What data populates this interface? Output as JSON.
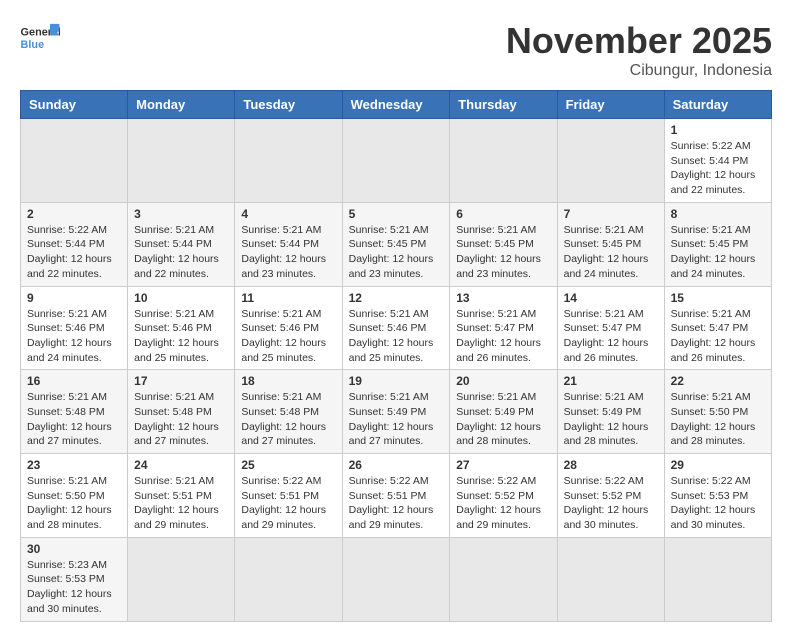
{
  "header": {
    "logo_general": "General",
    "logo_blue": "Blue",
    "title": "November 2025",
    "location": "Cibungur, Indonesia"
  },
  "weekdays": [
    "Sunday",
    "Monday",
    "Tuesday",
    "Wednesday",
    "Thursday",
    "Friday",
    "Saturday"
  ],
  "weeks": [
    [
      {
        "day": "",
        "info": ""
      },
      {
        "day": "",
        "info": ""
      },
      {
        "day": "",
        "info": ""
      },
      {
        "day": "",
        "info": ""
      },
      {
        "day": "",
        "info": ""
      },
      {
        "day": "",
        "info": ""
      },
      {
        "day": "1",
        "info": "Sunrise: 5:22 AM\nSunset: 5:44 PM\nDaylight: 12 hours and 22 minutes."
      }
    ],
    [
      {
        "day": "2",
        "info": "Sunrise: 5:22 AM\nSunset: 5:44 PM\nDaylight: 12 hours and 22 minutes."
      },
      {
        "day": "3",
        "info": "Sunrise: 5:21 AM\nSunset: 5:44 PM\nDaylight: 12 hours and 22 minutes."
      },
      {
        "day": "4",
        "info": "Sunrise: 5:21 AM\nSunset: 5:44 PM\nDaylight: 12 hours and 23 minutes."
      },
      {
        "day": "5",
        "info": "Sunrise: 5:21 AM\nSunset: 5:45 PM\nDaylight: 12 hours and 23 minutes."
      },
      {
        "day": "6",
        "info": "Sunrise: 5:21 AM\nSunset: 5:45 PM\nDaylight: 12 hours and 23 minutes."
      },
      {
        "day": "7",
        "info": "Sunrise: 5:21 AM\nSunset: 5:45 PM\nDaylight: 12 hours and 24 minutes."
      },
      {
        "day": "8",
        "info": "Sunrise: 5:21 AM\nSunset: 5:45 PM\nDaylight: 12 hours and 24 minutes."
      }
    ],
    [
      {
        "day": "9",
        "info": "Sunrise: 5:21 AM\nSunset: 5:46 PM\nDaylight: 12 hours and 24 minutes."
      },
      {
        "day": "10",
        "info": "Sunrise: 5:21 AM\nSunset: 5:46 PM\nDaylight: 12 hours and 25 minutes."
      },
      {
        "day": "11",
        "info": "Sunrise: 5:21 AM\nSunset: 5:46 PM\nDaylight: 12 hours and 25 minutes."
      },
      {
        "day": "12",
        "info": "Sunrise: 5:21 AM\nSunset: 5:46 PM\nDaylight: 12 hours and 25 minutes."
      },
      {
        "day": "13",
        "info": "Sunrise: 5:21 AM\nSunset: 5:47 PM\nDaylight: 12 hours and 26 minutes."
      },
      {
        "day": "14",
        "info": "Sunrise: 5:21 AM\nSunset: 5:47 PM\nDaylight: 12 hours and 26 minutes."
      },
      {
        "day": "15",
        "info": "Sunrise: 5:21 AM\nSunset: 5:47 PM\nDaylight: 12 hours and 26 minutes."
      }
    ],
    [
      {
        "day": "16",
        "info": "Sunrise: 5:21 AM\nSunset: 5:48 PM\nDaylight: 12 hours and 27 minutes."
      },
      {
        "day": "17",
        "info": "Sunrise: 5:21 AM\nSunset: 5:48 PM\nDaylight: 12 hours and 27 minutes."
      },
      {
        "day": "18",
        "info": "Sunrise: 5:21 AM\nSunset: 5:48 PM\nDaylight: 12 hours and 27 minutes."
      },
      {
        "day": "19",
        "info": "Sunrise: 5:21 AM\nSunset: 5:49 PM\nDaylight: 12 hours and 27 minutes."
      },
      {
        "day": "20",
        "info": "Sunrise: 5:21 AM\nSunset: 5:49 PM\nDaylight: 12 hours and 28 minutes."
      },
      {
        "day": "21",
        "info": "Sunrise: 5:21 AM\nSunset: 5:49 PM\nDaylight: 12 hours and 28 minutes."
      },
      {
        "day": "22",
        "info": "Sunrise: 5:21 AM\nSunset: 5:50 PM\nDaylight: 12 hours and 28 minutes."
      }
    ],
    [
      {
        "day": "23",
        "info": "Sunrise: 5:21 AM\nSunset: 5:50 PM\nDaylight: 12 hours and 28 minutes."
      },
      {
        "day": "24",
        "info": "Sunrise: 5:21 AM\nSunset: 5:51 PM\nDaylight: 12 hours and 29 minutes."
      },
      {
        "day": "25",
        "info": "Sunrise: 5:22 AM\nSunset: 5:51 PM\nDaylight: 12 hours and 29 minutes."
      },
      {
        "day": "26",
        "info": "Sunrise: 5:22 AM\nSunset: 5:51 PM\nDaylight: 12 hours and 29 minutes."
      },
      {
        "day": "27",
        "info": "Sunrise: 5:22 AM\nSunset: 5:52 PM\nDaylight: 12 hours and 29 minutes."
      },
      {
        "day": "28",
        "info": "Sunrise: 5:22 AM\nSunset: 5:52 PM\nDaylight: 12 hours and 30 minutes."
      },
      {
        "day": "29",
        "info": "Sunrise: 5:22 AM\nSunset: 5:53 PM\nDaylight: 12 hours and 30 minutes."
      }
    ],
    [
      {
        "day": "30",
        "info": "Sunrise: 5:23 AM\nSunset: 5:53 PM\nDaylight: 12 hours and 30 minutes."
      },
      {
        "day": "",
        "info": ""
      },
      {
        "day": "",
        "info": ""
      },
      {
        "day": "",
        "info": ""
      },
      {
        "day": "",
        "info": ""
      },
      {
        "day": "",
        "info": ""
      },
      {
        "day": "",
        "info": ""
      }
    ]
  ]
}
